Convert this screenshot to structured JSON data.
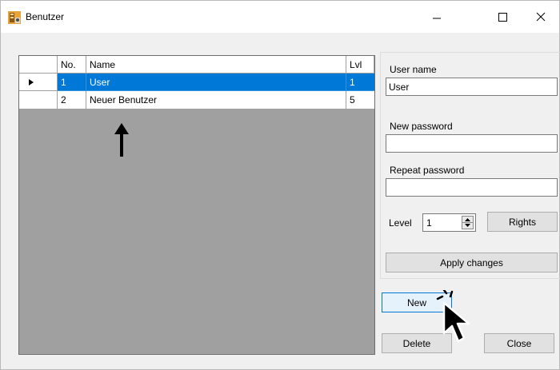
{
  "window": {
    "title": "Benutzer",
    "icon": "app-icon"
  },
  "titlebar_buttons": {
    "minimize": "minimize-icon",
    "maximize": "maximize-icon",
    "close": "close-icon"
  },
  "grid": {
    "columns": [
      "No.",
      "Name",
      "Lvl"
    ],
    "rows": [
      {
        "no": "1",
        "name": "User",
        "lvl": "1",
        "selected": true
      },
      {
        "no": "2",
        "name": "Neuer Benutzer",
        "lvl": "5",
        "selected": false
      }
    ]
  },
  "form": {
    "user_name_label": "User name",
    "user_name_value": "User",
    "new_password_label": "New password",
    "new_password_value": "",
    "repeat_password_label": "Repeat password",
    "repeat_password_value": "",
    "level_label": "Level",
    "level_value": "1",
    "rights_label": "Rights",
    "apply_label": "Apply changes"
  },
  "actions": {
    "new_label": "New",
    "delete_label": "Delete",
    "close_label": "Close"
  },
  "colors": {
    "selection": "#0078d7",
    "grid_background": "#a0a0a0",
    "window_background": "#f0f0f0"
  }
}
